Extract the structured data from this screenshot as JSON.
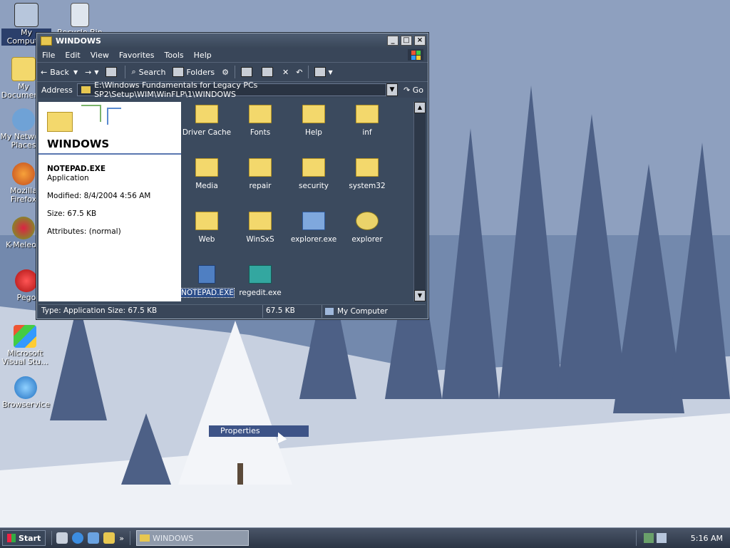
{
  "desktop_icons": [
    {
      "label": "My Computer",
      "icon": "computer-icon"
    },
    {
      "label": "Recycle Bin",
      "icon": "recycle-bin-icon"
    },
    {
      "label": "My Documents",
      "icon": "documents-folder-icon"
    },
    {
      "label": "My Network Places",
      "icon": "network-places-icon"
    },
    {
      "label": "Mozilla Firefox",
      "icon": "firefox-icon"
    },
    {
      "label": "K-Meleon",
      "icon": "kmeleon-icon"
    },
    {
      "label": "Pego",
      "icon": "pego-icon"
    },
    {
      "label": "Microsoft Visual Stu...",
      "icon": "visual-studio-icon"
    },
    {
      "label": "Browservice",
      "icon": "browser-icon"
    }
  ],
  "window": {
    "title": "WINDOWS",
    "menu": [
      "File",
      "Edit",
      "View",
      "Favorites",
      "Tools",
      "Help"
    ],
    "toolbar": {
      "back": "Back",
      "search": "Search",
      "folders": "Folders"
    },
    "address": {
      "label": "Address",
      "path": "E:\\Windows Fundamentals for Legacy PCs SP2\\Setup\\WIM\\WinFLP\\1\\WINDOWS",
      "go": "Go"
    },
    "left_panel": {
      "title": "WINDOWS",
      "file_name": "NOTEPAD.EXE",
      "file_type": "Application",
      "modified": "Modified: 8/4/2004 4:56 AM",
      "size": "Size: 67.5 KB",
      "attributes": "Attributes: (normal)"
    },
    "files": [
      {
        "name": "Driver Cache",
        "kind": "folder"
      },
      {
        "name": "Fonts",
        "kind": "folder"
      },
      {
        "name": "Help",
        "kind": "folder"
      },
      {
        "name": "inf",
        "kind": "folder"
      },
      {
        "name": "Media",
        "kind": "folder"
      },
      {
        "name": "repair",
        "kind": "folder"
      },
      {
        "name": "security",
        "kind": "folder"
      },
      {
        "name": "system32",
        "kind": "folder"
      },
      {
        "name": "Web",
        "kind": "folder"
      },
      {
        "name": "WinSxS",
        "kind": "folder"
      },
      {
        "name": "explorer.exe",
        "kind": "exe"
      },
      {
        "name": "explorer",
        "kind": "exe-search"
      },
      {
        "name": "NOTEPAD.EXE",
        "kind": "notepad"
      },
      {
        "name": "regedit.exe",
        "kind": "regedit"
      }
    ],
    "status": {
      "type_size": "Type: Application Size: 67.5 KB",
      "size": "67.5 KB",
      "location": "My Computer"
    }
  },
  "context_item": "Properties",
  "taskbar": {
    "start": "Start",
    "task": "WINDOWS",
    "clock": "5:16 AM"
  },
  "colors": {
    "window_bg": "#3b4a5e",
    "selection": "#2b4d8a",
    "folder": "#f3d86c"
  }
}
